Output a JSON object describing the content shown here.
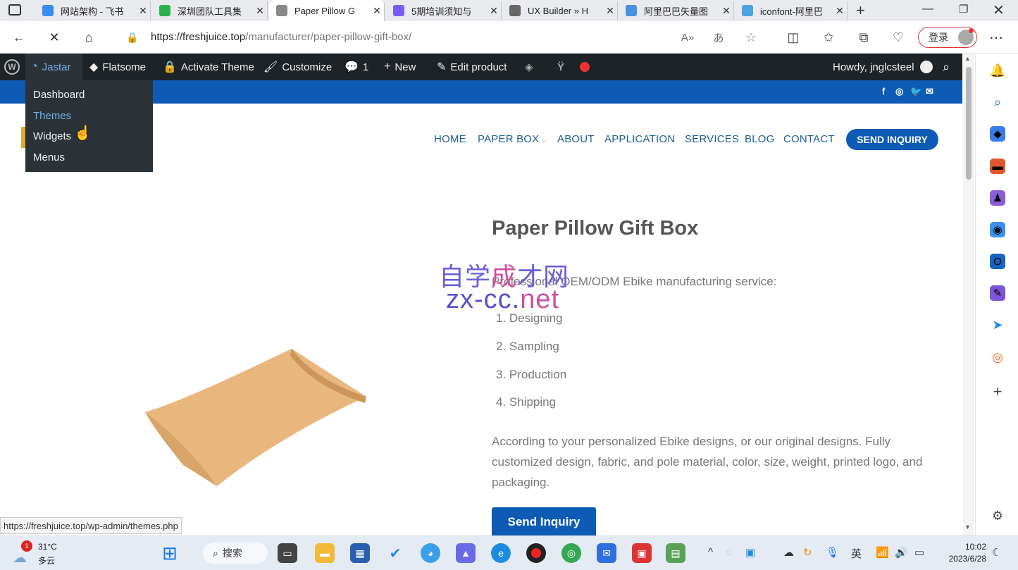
{
  "tabs": [
    {
      "title": "网站架构 - 飞书",
      "color": "#3b8df0",
      "active": false
    },
    {
      "title": "深圳团队工具集",
      "color": "#2bb24c",
      "active": false
    },
    {
      "title": "Paper Pillow G",
      "color": "#888",
      "active": true
    },
    {
      "title": "5期培训须知与",
      "color": "#7b5cf0",
      "active": false
    },
    {
      "title": "UX Builder » H",
      "color": "#666",
      "active": false
    },
    {
      "title": "阿里巴巴矢量图",
      "color": "#4a90e2",
      "active": false
    },
    {
      "title": "iconfont-阿里巴",
      "color": "#4aa3df",
      "active": false
    }
  ],
  "address": {
    "domain": "https://freshjuice.top",
    "path": "/manufacturer/paper-pillow-gift-box/",
    "login_label": "登录"
  },
  "adminbar": {
    "site": "Jastar",
    "flatsome": "Flatsome",
    "activate": "Activate Theme",
    "customize": "Customize",
    "comments": "1",
    "new": "New",
    "edit": "Edit product",
    "howdy": "Howdy, jnglcsteel"
  },
  "dropdown": [
    "Dashboard",
    "Themes",
    "Widgets",
    "Menus"
  ],
  "social": [
    "f",
    "◎",
    "🐦",
    "✉"
  ],
  "menu": [
    "HOME",
    "PAPER BOX",
    "ABOUT",
    "APPLICATION",
    "SERVICES",
    "BLOG",
    "CONTACT"
  ],
  "send_inquiry_nav": "SEND INQUIRY",
  "product": {
    "title": "Paper Pillow Gift Box",
    "intro": "Professional OEM/ODM Ebike manufacturing service:",
    "steps": [
      "1. Designing",
      "2. Sampling",
      "3. Production",
      "4. Shipping"
    ],
    "desc": "According to your personalized Ebike designs, or our original designs. Fully customized design, fabric, and pole material, color, size, weight, printed logo, and packaging.",
    "button": "Send Inquiry"
  },
  "watermark": {
    "line1a": "自学",
    "line1b": "成",
    "line1c": "才网",
    "line2a": "zx-cc.",
    "line2b": "net"
  },
  "status_url": "https://freshjuice.top/wp-admin/themes.php",
  "taskbar": {
    "weather_badge": "1",
    "temp": "31°C",
    "cond": "多云",
    "search": "搜索",
    "ime": "英",
    "time": "10:02",
    "date": "2023/6/28"
  },
  "colors": {
    "wp_dark": "#1d2327",
    "brand_blue": "#0e5bb5",
    "menu_text": "#1e5e96"
  }
}
